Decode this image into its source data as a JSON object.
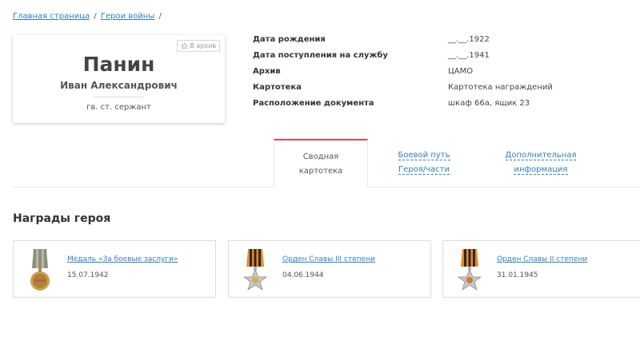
{
  "breadcrumb": {
    "home": "Главная страница",
    "section": "Герои войны",
    "separator": "/"
  },
  "hero": {
    "surname": "Панин",
    "given_names": "Иван Александрович",
    "rank": "гв. ст. сержант",
    "archive_button": "В архив"
  },
  "info": [
    {
      "label": "Дата рождения",
      "value": "__.__.1922"
    },
    {
      "label": "Дата поступления на службу",
      "value": "__.__.1941"
    },
    {
      "label": "Архив",
      "value": "ЦАМО"
    },
    {
      "label": "Картотека",
      "value": "Картотека награждений"
    },
    {
      "label": "Расположение документа",
      "value": "шкаф 66а, ящик 23"
    }
  ],
  "tabs": {
    "summary": [
      "Сводная",
      "картотека"
    ],
    "battle": [
      "Боевой путь",
      "Героя/части"
    ],
    "extra": [
      "Дополнительная",
      "информация"
    ]
  },
  "awards_title": "Награды героя",
  "awards": [
    {
      "name": "Медаль «За боевые заслуги»",
      "date": "15.07.1942",
      "icon": "medal-combat-merit-icon"
    },
    {
      "name": "Орден Славы III степени",
      "date": "04.06.1944",
      "icon": "order-glory-3-icon"
    },
    {
      "name": "Орден Славы II степени",
      "date": "31.01.1945",
      "icon": "order-glory-2-icon"
    }
  ],
  "colors": {
    "link": "#2f7fc1",
    "active_tab": "#e64545",
    "ribbon_orange": "#e8892b",
    "ribbon_black": "#2a2a2a"
  }
}
